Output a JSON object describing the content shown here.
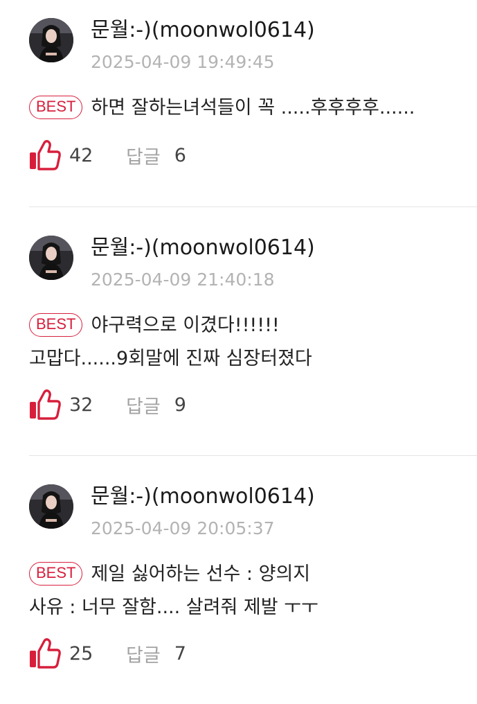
{
  "comments": [
    {
      "author": "문월:-)(moonwol0614)",
      "timestamp": "2025-04-09 19:49:45",
      "badge": "BEST",
      "lines": [
        "하면 잘하는녀석들이 꼭 .....후후후후......"
      ],
      "likes": "42",
      "reply_label": "답글",
      "reply_count": "6"
    },
    {
      "author": "문월:-)(moonwol0614)",
      "timestamp": "2025-04-09 21:40:18",
      "badge": "BEST",
      "lines": [
        "야구력으로 이겼다!!!!!!",
        "고맙다......9회말에 진짜 심장터졌다"
      ],
      "likes": "32",
      "reply_label": "답글",
      "reply_count": "9"
    },
    {
      "author": "문월:-)(moonwol0614)",
      "timestamp": "2025-04-09 20:05:37",
      "badge": "BEST",
      "lines": [
        "제일 싫어하는 선수 : 양의지",
        "사유 : 너무 잘함.... 살려줘 제발 ㅜㅜ"
      ],
      "likes": "25",
      "reply_label": "답글",
      "reply_count": "7"
    }
  ],
  "colors": {
    "accent": "#d71f3c",
    "author_text": "#1a1a1a",
    "timestamp_text": "#b3b3b3",
    "reply_label_text": "#a3a3a3",
    "divider": "#e3e3e3"
  },
  "icons": {
    "like": "thumbs-up-icon",
    "avatar": "user-avatar"
  }
}
